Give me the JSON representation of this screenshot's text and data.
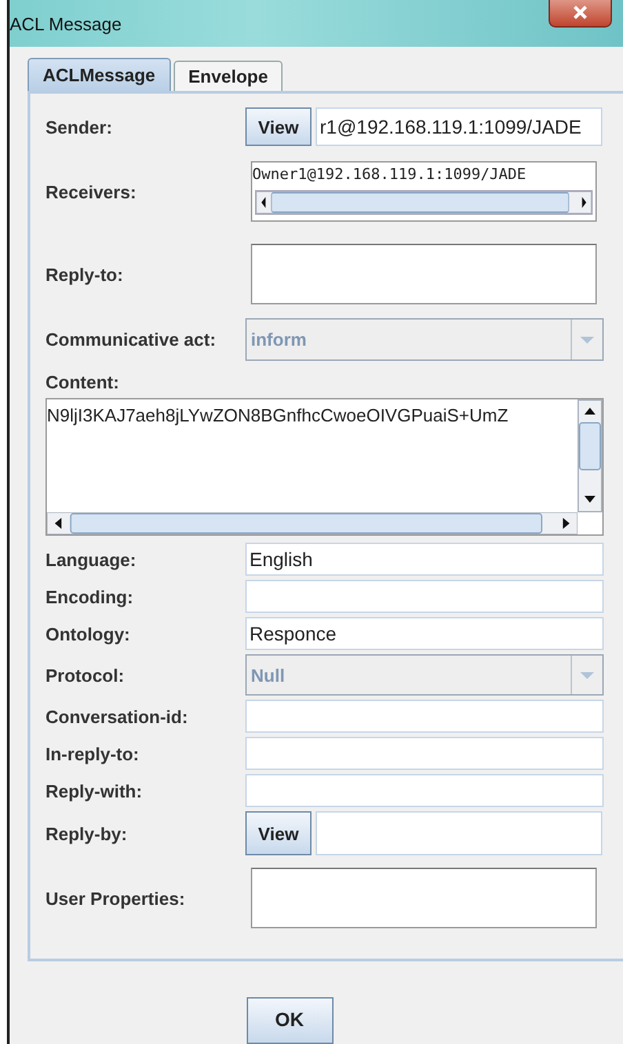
{
  "window": {
    "title": "ACL Message"
  },
  "tabs": [
    {
      "label": "ACLMessage",
      "selected": true
    },
    {
      "label": "Envelope",
      "selected": false
    }
  ],
  "fields": [
    {
      "kind": "view",
      "label": "Sender:",
      "button": "View",
      "value": "r1@192.168.119.1:1099/JADE"
    },
    {
      "kind": "list",
      "label": "Receivers:",
      "value": "Owner1@192.168.119.1:1099/JADE"
    },
    {
      "kind": "box",
      "label": "Reply-to:"
    },
    {
      "kind": "combo",
      "label": "Communicative act:",
      "value": "inform",
      "disabled": true
    },
    {
      "kind": "content",
      "label": "Content:",
      "value": "N9ljI3KAJ7aeh8jLYwZON8BGnfhcCwoeOIVGPuaiS+UmZ"
    },
    {
      "kind": "text",
      "label": "Language:",
      "value": "English"
    },
    {
      "kind": "text",
      "label": "Encoding:"
    },
    {
      "kind": "text",
      "label": "Ontology:",
      "value": "Responce"
    },
    {
      "kind": "combo",
      "label": "Protocol:",
      "value": "Null",
      "disabled": true
    },
    {
      "kind": "text",
      "label": "Conversation-id:"
    },
    {
      "kind": "text",
      "label": "In-reply-to:"
    },
    {
      "kind": "text",
      "label": "Reply-with:"
    },
    {
      "kind": "view",
      "label": "Reply-by:",
      "button": "View"
    },
    {
      "kind": "box",
      "label": "User Properties:"
    }
  ],
  "buttons": [
    {
      "label": "OK"
    }
  ]
}
